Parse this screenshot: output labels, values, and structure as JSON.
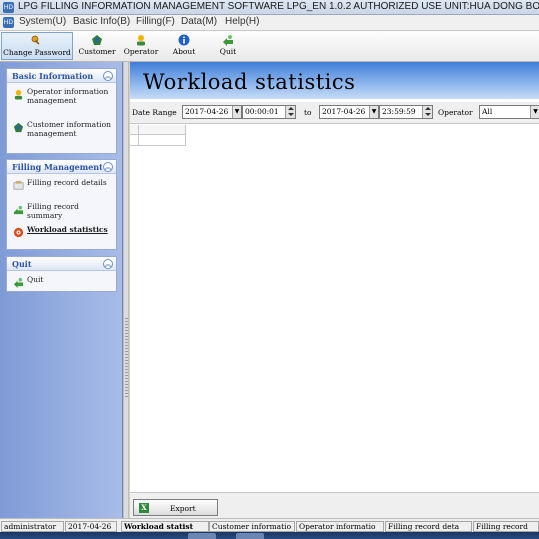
{
  "window": {
    "title": "LPG FILLING INFORMATION MANAGEMENT SOFTWARE LPG_EN 1.0.2 AUTHORIZED USE UNIT:HUA DONG BOTTLE GAS ST"
  },
  "menu": [
    "System(U)",
    "Basic Info(B)",
    "Filling(F)",
    "Data(M)",
    "Help(H)"
  ],
  "toolbar": [
    {
      "label": "Change Password",
      "icon": "key-icon"
    },
    {
      "label": "Customer",
      "icon": "customer-icon"
    },
    {
      "label": "Operator",
      "icon": "operator-icon"
    },
    {
      "label": "About",
      "icon": "info-icon"
    },
    {
      "label": "Quit",
      "icon": "quit-icon"
    }
  ],
  "sidebar": {
    "basic": {
      "header": "Basic Information",
      "items": [
        "Operator information management",
        "Customer information management"
      ]
    },
    "filling": {
      "header": "Filling Management",
      "items": [
        "Filling record details",
        "Filling record summary",
        "Workload statistics"
      ]
    },
    "quit": {
      "header": "Quit",
      "items": [
        "Quit"
      ]
    }
  },
  "main": {
    "title": "Workload statistics",
    "filter": {
      "date_range_label": "Date Range",
      "from_date": "2017-04-26",
      "from_time": "00:00:01",
      "to_label": "to",
      "to_date": "2017-04-26",
      "to_time": "23:59:59",
      "operator_label": "Operator",
      "operator_value": "All"
    },
    "export_label": "Export"
  },
  "status": [
    "administrator",
    "2017-04-26",
    "Workload statist",
    "Customer informatio",
    "Operator informatio",
    "Filling record deta",
    "Filling record"
  ],
  "colors": {
    "accent": "#3f7fd7",
    "sidebar": "#7f9bd6",
    "header_text": "#2f55a8"
  }
}
